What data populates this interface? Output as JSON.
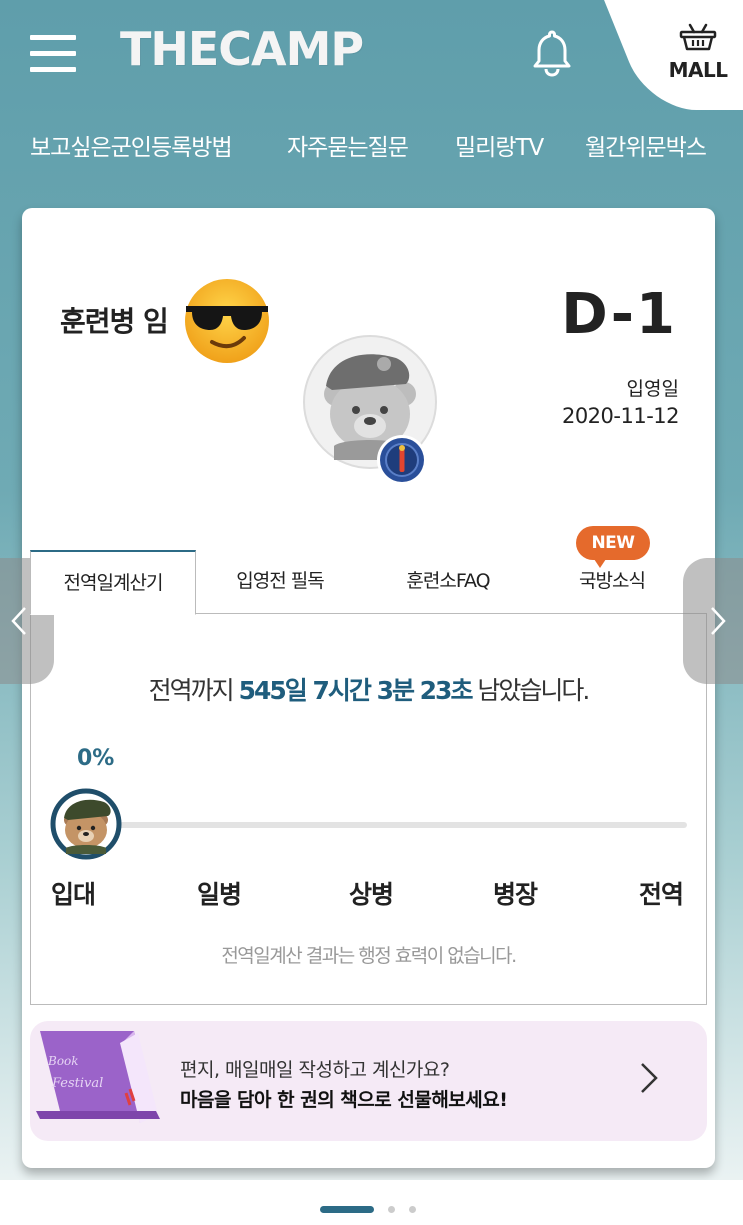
{
  "header": {
    "logo_text": "THECAMP",
    "mall_label": "MALL"
  },
  "nav": {
    "items": [
      "보고싶은군인등록방법",
      "자주묻는질문",
      "밀리랑TV",
      "월간위문박스"
    ]
  },
  "profile": {
    "trainee_label": "훈련병 임",
    "dday": "D-1",
    "enlist_label": "입영일",
    "enlist_date": "2020-11-12"
  },
  "tabs": {
    "items": [
      "전역일계산기",
      "입영전 필독",
      "훈련소FAQ",
      "국방소식"
    ],
    "active_index": 0,
    "new_badge": "NEW"
  },
  "calculator": {
    "prefix": "전역까지 ",
    "remaining": "545일 7시간 3분 23초",
    "suffix": " 남았습니다.",
    "progress_label": "0%",
    "progress_fraction": 0.0,
    "ranks": [
      "입대",
      "일병",
      "상병",
      "병장",
      "전역"
    ],
    "disclaimer": "전역일계산 결과는 행정 효력이 없습니다."
  },
  "banner": {
    "line1": "편지, 매일매일 작성하고 계신가요?",
    "line2": "마음을 담아 한 권의 책으로 선물해보세요!",
    "book_text": "Book Festival"
  },
  "colors": {
    "header_bg": "#5f9eab",
    "accent": "#2c6b86",
    "new_badge": "#e56a2c",
    "banner_bg": "#f5eaf6"
  },
  "icons": [
    "menu-icon",
    "bell-icon",
    "basket-icon",
    "sunglasses-emoji",
    "army-badge-icon",
    "chevron-left-icon",
    "chevron-right-icon",
    "chevron-right-banner-icon"
  ]
}
